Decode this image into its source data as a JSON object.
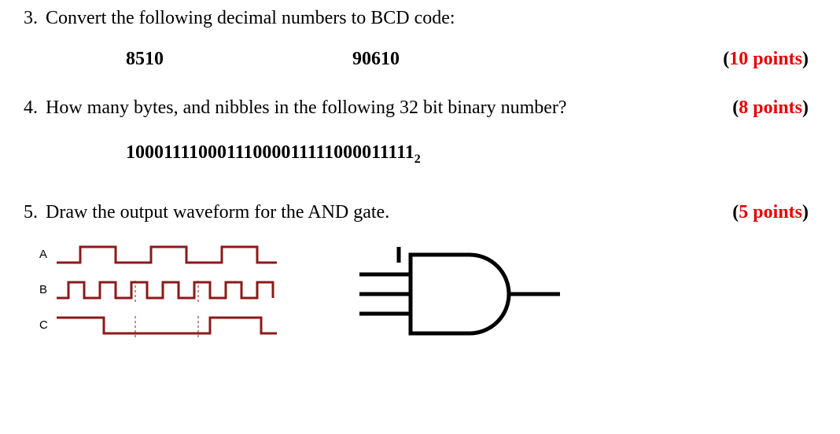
{
  "q3": {
    "number": "3.",
    "text": "Convert the following decimal numbers to BCD code:",
    "value1": "8510",
    "value2": "90610",
    "points_num": "10",
    "points_label": "points"
  },
  "q4": {
    "number": "4.",
    "text": "How many bytes, and nibbles in the following 32 bit binary number?",
    "binary": "10001111000111000011111000011111",
    "subscript": "2",
    "points_num": "8",
    "points_label": "points"
  },
  "q5": {
    "number": "5.",
    "text": "Draw the output waveform for the AND gate.",
    "points_num": "5",
    "points_label": "points",
    "labelA": "A",
    "labelB": "B",
    "labelC": "C"
  }
}
